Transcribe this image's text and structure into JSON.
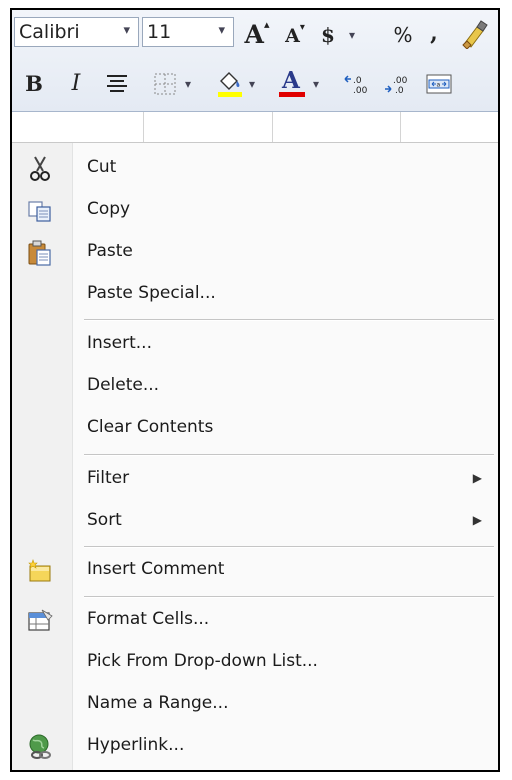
{
  "minibar": {
    "font_name": "Calibri",
    "font_size": "11",
    "bold_label": "B",
    "italic_label": "I",
    "grow_font_label": "A",
    "shrink_font_label": "A",
    "currency_label": "$",
    "percent_label": "%",
    "comma_label": ",",
    "font_color_label": "A",
    "fill_color": "#ffff00",
    "font_color": "#e00000"
  },
  "menu": {
    "items": [
      {
        "label": "Cut",
        "icon": "scissors-icon"
      },
      {
        "label": "Copy",
        "icon": "copy-icon"
      },
      {
        "label": "Paste",
        "icon": "paste-icon"
      },
      {
        "label": "Paste Special..."
      },
      {
        "label": "Insert..."
      },
      {
        "label": "Delete..."
      },
      {
        "label": "Clear Contents"
      },
      {
        "label": "Filter",
        "submenu": true
      },
      {
        "label": "Sort",
        "submenu": true
      },
      {
        "label": "Insert Comment",
        "icon": "insert-comment-icon"
      },
      {
        "label": "Format Cells...",
        "icon": "format-cells-icon"
      },
      {
        "label": "Pick From Drop-down List..."
      },
      {
        "label": "Name a Range..."
      },
      {
        "label": "Hyperlink...",
        "icon": "hyperlink-icon"
      }
    ]
  }
}
